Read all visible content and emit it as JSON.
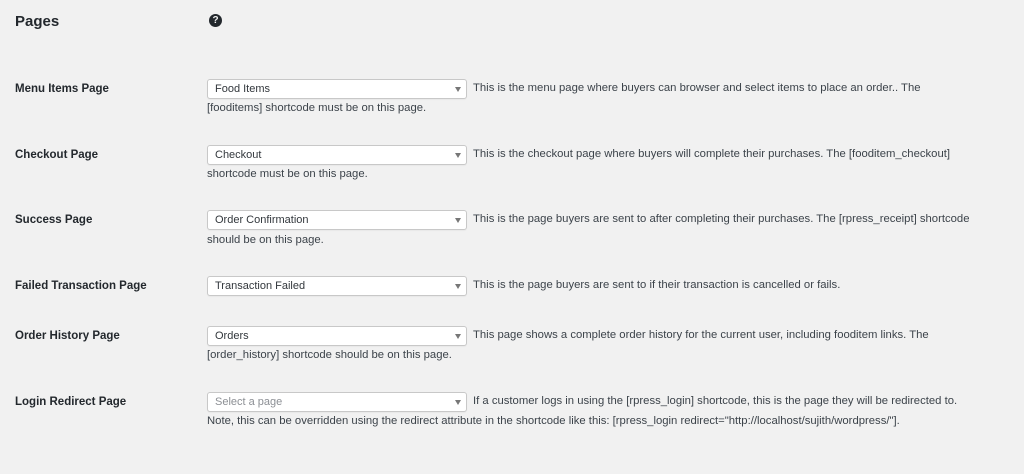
{
  "section": {
    "title": "Pages",
    "help_icon": "question-circle-icon"
  },
  "rows": [
    {
      "label": "Menu Items Page",
      "select_value": "Food Items",
      "desc_line1": "This is the menu page where buyers can browser and select items to place an order.. The",
      "desc_line2": "[fooditems] shortcode must be on this page."
    },
    {
      "label": "Checkout Page",
      "select_value": "Checkout",
      "desc_line1": "This is the checkout page where buyers will complete their purchases. The [fooditem_checkout]",
      "desc_line2": "shortcode must be on this page."
    },
    {
      "label": "Success Page",
      "select_value": "Order Confirmation",
      "desc_line1": "This is the page buyers are sent to after completing their purchases. The [rpress_receipt] shortcode",
      "desc_line2": "should be on this page."
    },
    {
      "label": "Failed Transaction Page",
      "select_value": "Transaction Failed",
      "desc_line1": "This is the page buyers are sent to if their transaction is cancelled or fails."
    },
    {
      "label": "Order History Page",
      "select_value": "Orders",
      "desc_line1": "This page shows a complete order history for the current user, including fooditem links. The",
      "desc_line2": "[order_history] shortcode should be on this page."
    },
    {
      "label": "Login Redirect Page",
      "select_placeholder": "Select a page",
      "desc_line1": "If a customer logs in using the [rpress_login] shortcode, this is the page they will be redirected to.",
      "desc_line2": "Note, this can be overridden using the redirect attribute in the shortcode like this: [rpress_login redirect=\"http://localhost/sujith/wordpress/\"]."
    }
  ]
}
